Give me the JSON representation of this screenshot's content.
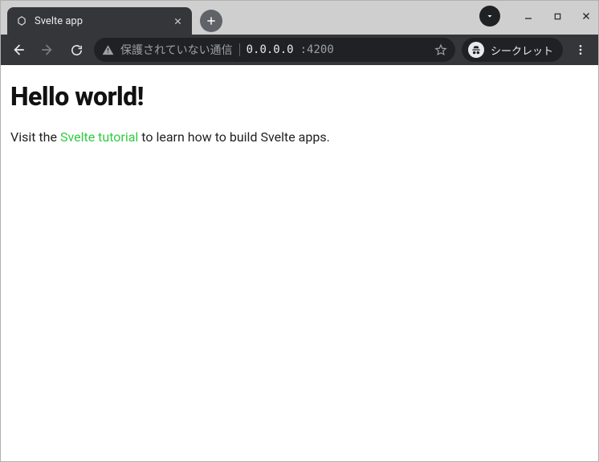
{
  "tab": {
    "title": "Svelte app"
  },
  "omnibox": {
    "security_text": "保護されていない通信",
    "url_host": "0.0.0.0",
    "url_port": ":4200"
  },
  "incognito": {
    "label": "シークレット"
  },
  "page": {
    "heading": "Hello world!",
    "text_before": "Visit the ",
    "link_text": "Svelte tutorial",
    "text_after": " to learn how to build Svelte apps."
  }
}
